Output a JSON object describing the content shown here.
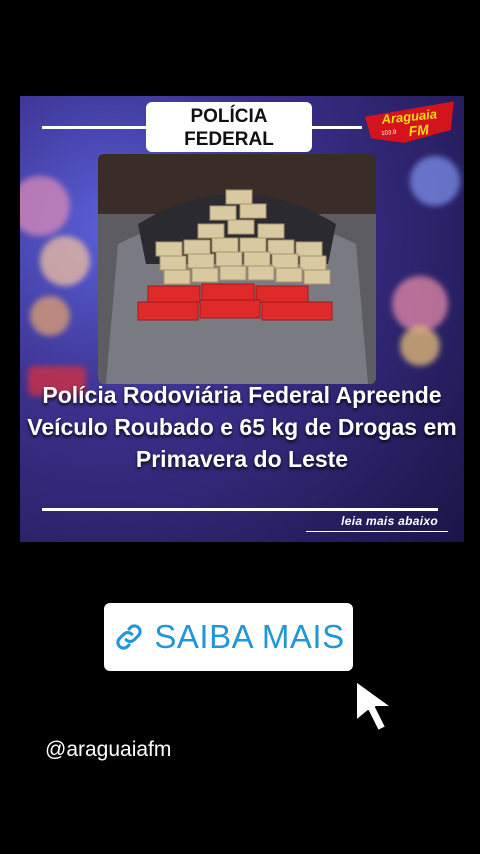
{
  "card": {
    "badge_line1": "POLÍCIA",
    "badge_line2": "FEDERAL",
    "logo_text": "Araguaia",
    "logo_fm": "FM",
    "logo_freq": "103.9",
    "headline": "Polícia Rodoviária Federal Apreende Veículo Roubado e 65 kg de Drogas em Primavera do Leste",
    "read_more": "leia mais abaixo"
  },
  "link_sticker": {
    "label": "SAIBA MAIS",
    "icon": "link-icon"
  },
  "account": {
    "handle": "@araguaiafm"
  },
  "colors": {
    "background": "#000000",
    "link_blue": "#2196d8",
    "logo_red": "#d4141c",
    "logo_yellow": "#f7d917"
  }
}
